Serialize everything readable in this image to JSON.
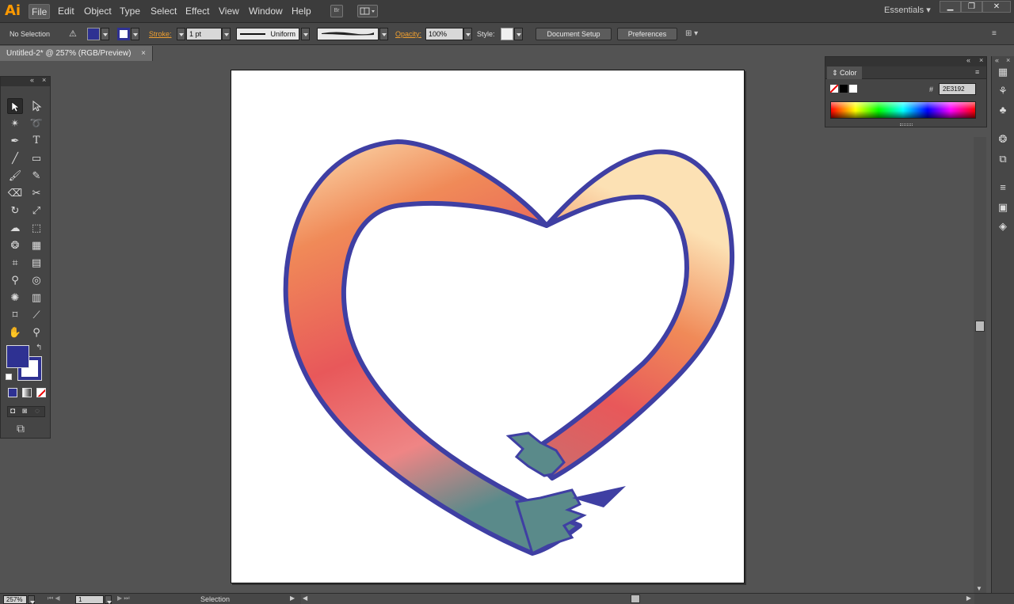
{
  "app": {
    "logo": "Ai",
    "workspace": "Essentials"
  },
  "menu": [
    "File",
    "Edit",
    "Object",
    "Type",
    "Select",
    "Effect",
    "View",
    "Window",
    "Help"
  ],
  "menu_badge": "Br",
  "control_bar": {
    "selection_label": "No Selection",
    "fill_color": "#2E3192",
    "stroke_label": "Stroke:",
    "stroke_weight": "1 pt",
    "stroke_profile": "Uniform",
    "opacity_label": "Opacity:",
    "opacity_value": "100%",
    "style_label": "Style:",
    "document_setup": "Document Setup",
    "preferences": "Preferences"
  },
  "document_tab": {
    "title": "Untitled-2* @ 257% (RGB/Preview)",
    "close": "×"
  },
  "color_panel": {
    "title": "Color",
    "hex_label": "#",
    "hex_value": "2E3192"
  },
  "status_bar": {
    "zoom": "257%",
    "artboard": "1",
    "status": "Selection"
  },
  "colors": {
    "accent": "#ff9a00",
    "heart_outline": "#3f3fa3",
    "gradient_top": "#fce1b4",
    "gradient_mid": "#f07a55",
    "gradient_red": "#e8565a",
    "gradient_pink": "#ee8888",
    "gradient_end": "#5a8a8a"
  }
}
